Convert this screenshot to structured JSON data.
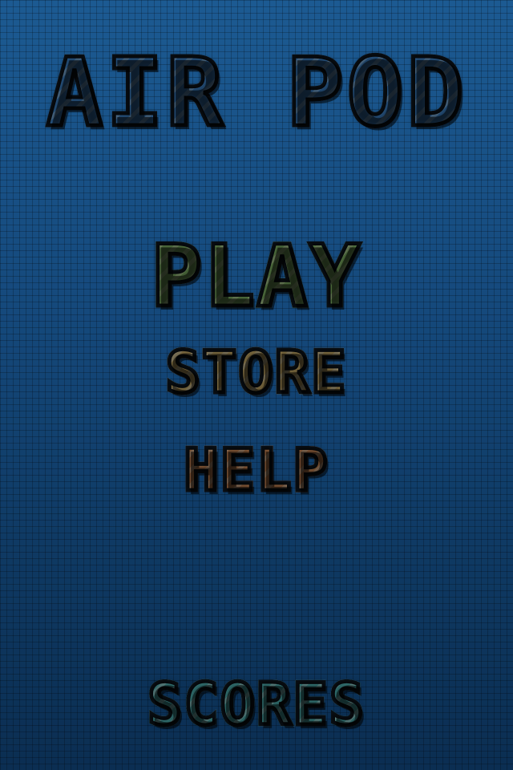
{
  "title": {
    "text": "AIR POD",
    "color": "#4a9ef2",
    "stripe_color": "#8cc8ff"
  },
  "menu": {
    "play": {
      "label": "PLAY",
      "color": "#9bd97a",
      "stripe_color": "#c9f0a6"
    },
    "store": {
      "label": "STORE",
      "color": "#f2cf7c",
      "stripe_color": "#fbe6b0"
    },
    "help": {
      "label": "HELP",
      "color": "#f0a065",
      "stripe_color": "#f8c79c"
    },
    "scores": {
      "label": "SCORES",
      "color": "#5ed6d6",
      "stripe_color": "#a5f0ef"
    }
  }
}
